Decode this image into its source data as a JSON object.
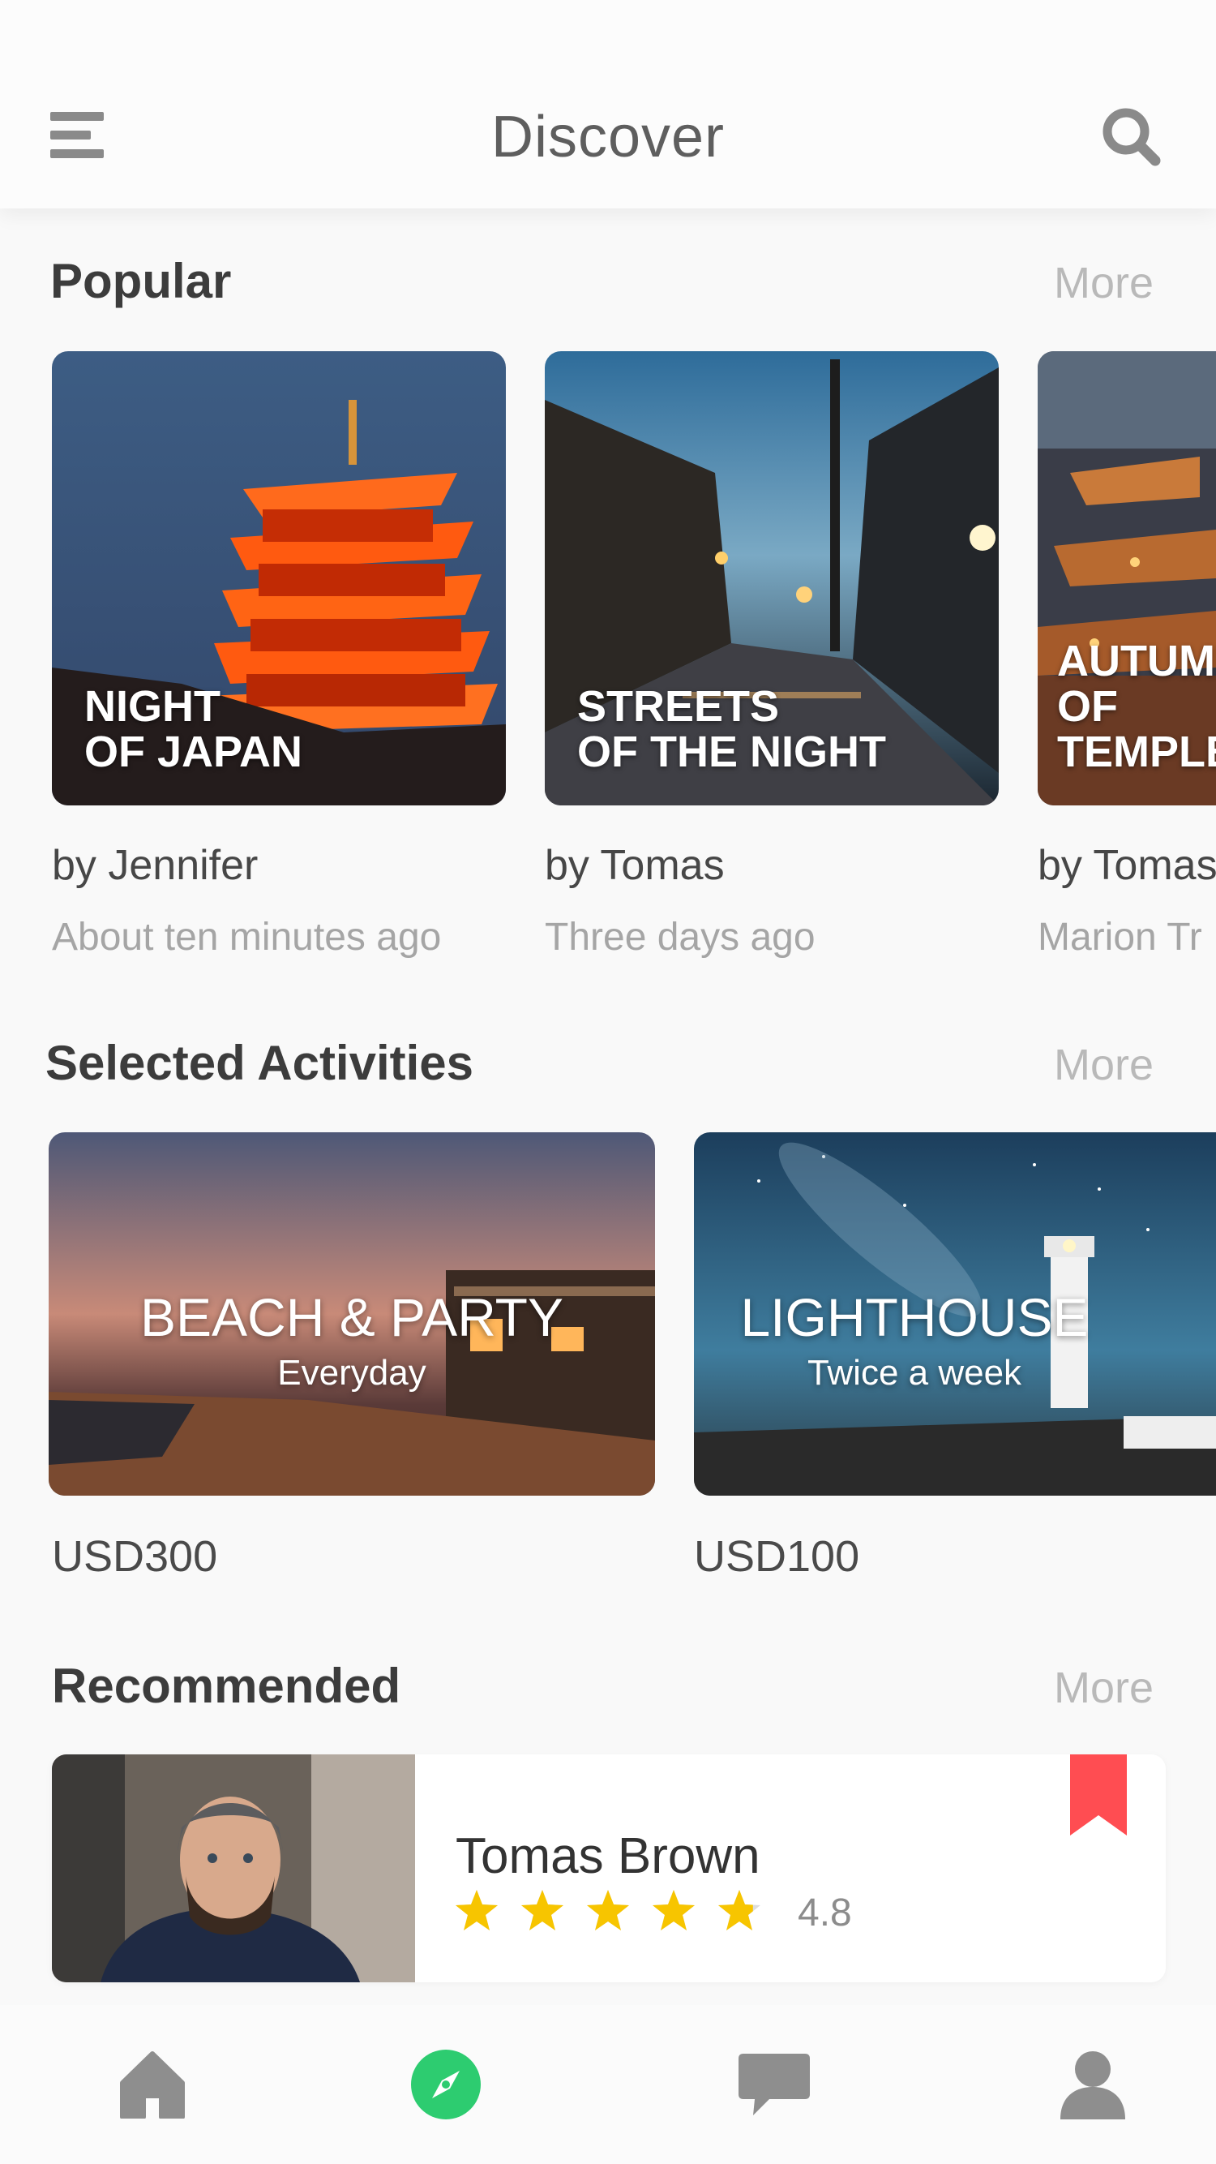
{
  "header": {
    "title": "Discover"
  },
  "popular": {
    "title": "Popular",
    "more": "More",
    "cards": [
      {
        "caption_line1": "NIGHT",
        "caption_line2": "OF JAPAN",
        "author": "by Jennifer",
        "time": "About ten minutes ago"
      },
      {
        "caption_line1": "STREETS",
        "caption_line2": "OF THE NIGHT",
        "author": "by Tomas",
        "time": "Three days ago"
      },
      {
        "caption_line1": "AUTUMN",
        "caption_line2": "OF TEMPLES",
        "author": "by Tomas",
        "time": "Marion Tr"
      }
    ]
  },
  "activities": {
    "title": "Selected Activities",
    "more": "More",
    "cards": [
      {
        "title": "BEACH & PARTY",
        "subtitle": "Everyday",
        "price": "USD300"
      },
      {
        "title": "LIGHTHOUSE",
        "subtitle": "Twice a week",
        "price": "USD100"
      }
    ]
  },
  "recommended": {
    "title": "Recommended",
    "more": "More",
    "item": {
      "name": "Tomas Brown",
      "rating": 4.8,
      "rating_text": "4.8",
      "stars_max": 5
    }
  },
  "colors": {
    "accent": "#2dcc70",
    "bookmark": "#ff4d52",
    "star": "#f7c500"
  },
  "tabbar": {
    "items": [
      {
        "icon": "home-icon",
        "active": false
      },
      {
        "icon": "compass-icon",
        "active": true
      },
      {
        "icon": "chat-icon",
        "active": false
      },
      {
        "icon": "profile-icon",
        "active": false
      }
    ]
  }
}
